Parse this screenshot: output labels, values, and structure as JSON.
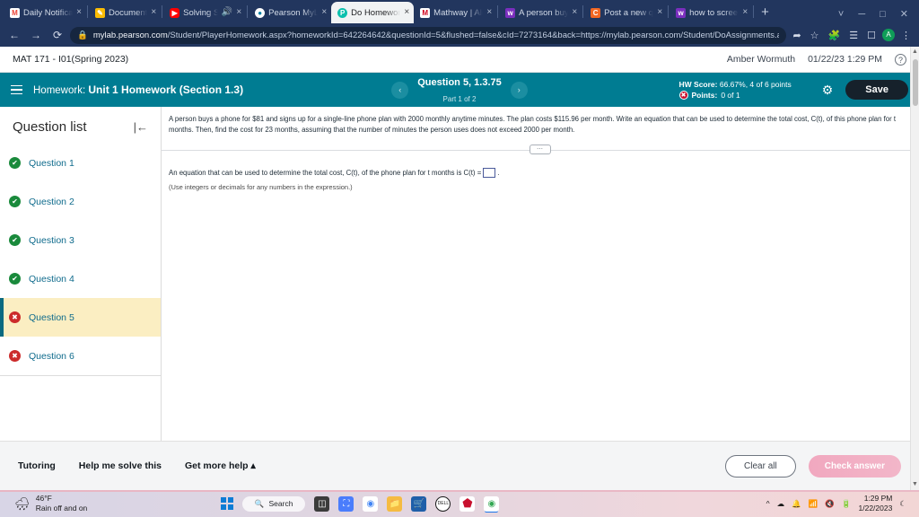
{
  "browser": {
    "tabs": [
      {
        "title": "Daily Notificat",
        "favicon": "gmail-icon",
        "active": false
      },
      {
        "title": "Document",
        "favicon": "google-docs-icon",
        "active": false
      },
      {
        "title": "Solving Sy",
        "favicon": "youtube-icon",
        "active": false,
        "muted": true
      },
      {
        "title": "Pearson MyLab",
        "favicon": "pearson-globe-icon",
        "active": false
      },
      {
        "title": "Do Homework",
        "favicon": "pearson-p-icon",
        "active": true
      },
      {
        "title": "Mathway | Alg",
        "favicon": "mathway-icon",
        "active": false
      },
      {
        "title": "A person buys",
        "favicon": "wyzant-icon",
        "active": false
      },
      {
        "title": "Post a new qu",
        "favicon": "chegg-icon",
        "active": false
      },
      {
        "title": "how to screen",
        "favicon": "wyzant-icon",
        "active": false
      }
    ],
    "new_tab_label": "+",
    "close_label": "×",
    "window_controls": [
      "chevron-down-icon",
      "minimize-icon",
      "maximize-icon",
      "close-icon"
    ],
    "nav": {
      "back": "←",
      "forward": "→",
      "reload": "⟳"
    },
    "omnibox": {
      "lock": "lock-icon",
      "url_host": "mylab.pearson.com",
      "url_path": "/Student/PlayerHomework.aspx?homeworkId=642264642&questionId=5&flushed=false&cId=7273164&back=https://mylab.pearson.com/Student/DoAssignments.as…"
    },
    "toolbar_icons": [
      "share-icon",
      "bookmark-star-icon",
      "extensions-puzzle-icon",
      "reading-list-icon",
      "split-screen-icon",
      "profile-avatar-icon",
      "more-menu-icon"
    ],
    "profile_initial": "A"
  },
  "pearson": {
    "course_title": "MAT 171 - I01(Spring 2023)",
    "user_name": "Amber Wormuth",
    "datetime": "01/22/23 1:29 PM",
    "help_icon_label": "?"
  },
  "homework_bar": {
    "menu_icon": "hamburger-menu-icon",
    "label_prefix": "Homework:",
    "assignment_name": "Unit 1 Homework (Section 1.3)",
    "prev_icon": "‹",
    "next_icon": "›",
    "question_title": "Question 5, 1.3.75",
    "question_part": "Part 1 of 2",
    "hw_score_label": "HW Score:",
    "hw_score_value": "66.67%, 4 of 6 points",
    "points_label": "Points:",
    "points_value": "0 of 1",
    "gear_icon": "settings-gear-icon",
    "save_label": "Save"
  },
  "question_list": {
    "heading": "Question list",
    "collapse_icon": "collapse-panel-icon",
    "items": [
      {
        "label": "Question 1",
        "status": "correct",
        "glyph": "✔",
        "active": false
      },
      {
        "label": "Question 2",
        "status": "correct",
        "glyph": "✔",
        "active": false
      },
      {
        "label": "Question 3",
        "status": "correct",
        "glyph": "✔",
        "active": false
      },
      {
        "label": "Question 4",
        "status": "correct",
        "glyph": "✔",
        "active": false
      },
      {
        "label": "Question 5",
        "status": "incorrect",
        "glyph": "✖",
        "active": true
      },
      {
        "label": "Question 6",
        "status": "incorrect",
        "glyph": "✖",
        "active": false
      }
    ]
  },
  "question": {
    "prompt": "A person buys a phone for $81 and signs up for a single-line phone plan with 2000 monthly anytime minutes. The plan costs $115.96 per month. Write an equation that can be used to determine the total cost, C(t), of this phone plan for t months. Then, find the cost for 23 months, assuming that the number of minutes the person uses does not exceed 2000 per month.",
    "grip_icon": "drag-handle-icon",
    "answer_prefix": "An equation that can be used to determine the total cost, C(t), of the phone plan for t months is C(t) =",
    "answer_value": "",
    "answer_suffix": ".",
    "hint": "(Use integers or decimals for any numbers in the expression.)"
  },
  "footer": {
    "tutoring": "Tutoring",
    "help_solve": "Help me solve this",
    "get_more_help": "Get more help",
    "get_more_help_caret": "▴",
    "clear_all": "Clear all",
    "check_answer": "Check answer"
  },
  "taskbar": {
    "weather_icon": "rain-cloud-icon",
    "temperature": "46°F",
    "condition": "Rain off and on",
    "start_icon": "windows-start-icon",
    "search_icon": "search-icon",
    "search_label": "Search",
    "apps": [
      {
        "name": "task-view-icon",
        "glyph": "◱",
        "color": "#3b3b3b"
      },
      {
        "name": "zoom-icon",
        "glyph": "■",
        "color": "#4a7dfc"
      },
      {
        "name": "chrome-icon",
        "glyph": "●",
        "color": "#f4b400"
      },
      {
        "name": "file-explorer-icon",
        "glyph": "▬",
        "color": "#f5bb41"
      },
      {
        "name": "microsoft-store-icon",
        "glyph": "⊞",
        "color": "#1f5fa9"
      },
      {
        "name": "dell-icon",
        "glyph": "DELL",
        "color": "#1b1b1b"
      },
      {
        "name": "mcafee-icon",
        "glyph": "⬟",
        "color": "#c8102e"
      },
      {
        "name": "chrome-active-icon",
        "glyph": "●",
        "color": "#34a853"
      }
    ],
    "tray_icons": [
      "show-hidden-icons-chevron",
      "onedrive-icon",
      "notification-icon",
      "wifi-icon",
      "volume-muted-icon",
      "battery-icon",
      "moon-icon"
    ],
    "clock_time": "1:29 PM",
    "clock_date": "1/22/2023"
  }
}
